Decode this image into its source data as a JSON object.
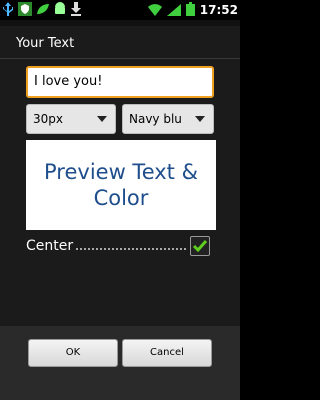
{
  "status_bar": {
    "time": "17:52",
    "icons": [
      "usb-icon",
      "shield-icon",
      "leaf-icon",
      "android-icon",
      "download-icon",
      "wifi-icon",
      "signal-icon",
      "battery-icon"
    ]
  },
  "dialog": {
    "title": "Your Text",
    "text_value": "I love you!",
    "size_value": "30px",
    "color_value": "Navy blu",
    "preview_text": "Preview Text  & Color",
    "preview_color": "#1f4e8c",
    "center_label": "Center",
    "center_checked": true,
    "ok_label": "OK",
    "cancel_label": "Cancel"
  }
}
